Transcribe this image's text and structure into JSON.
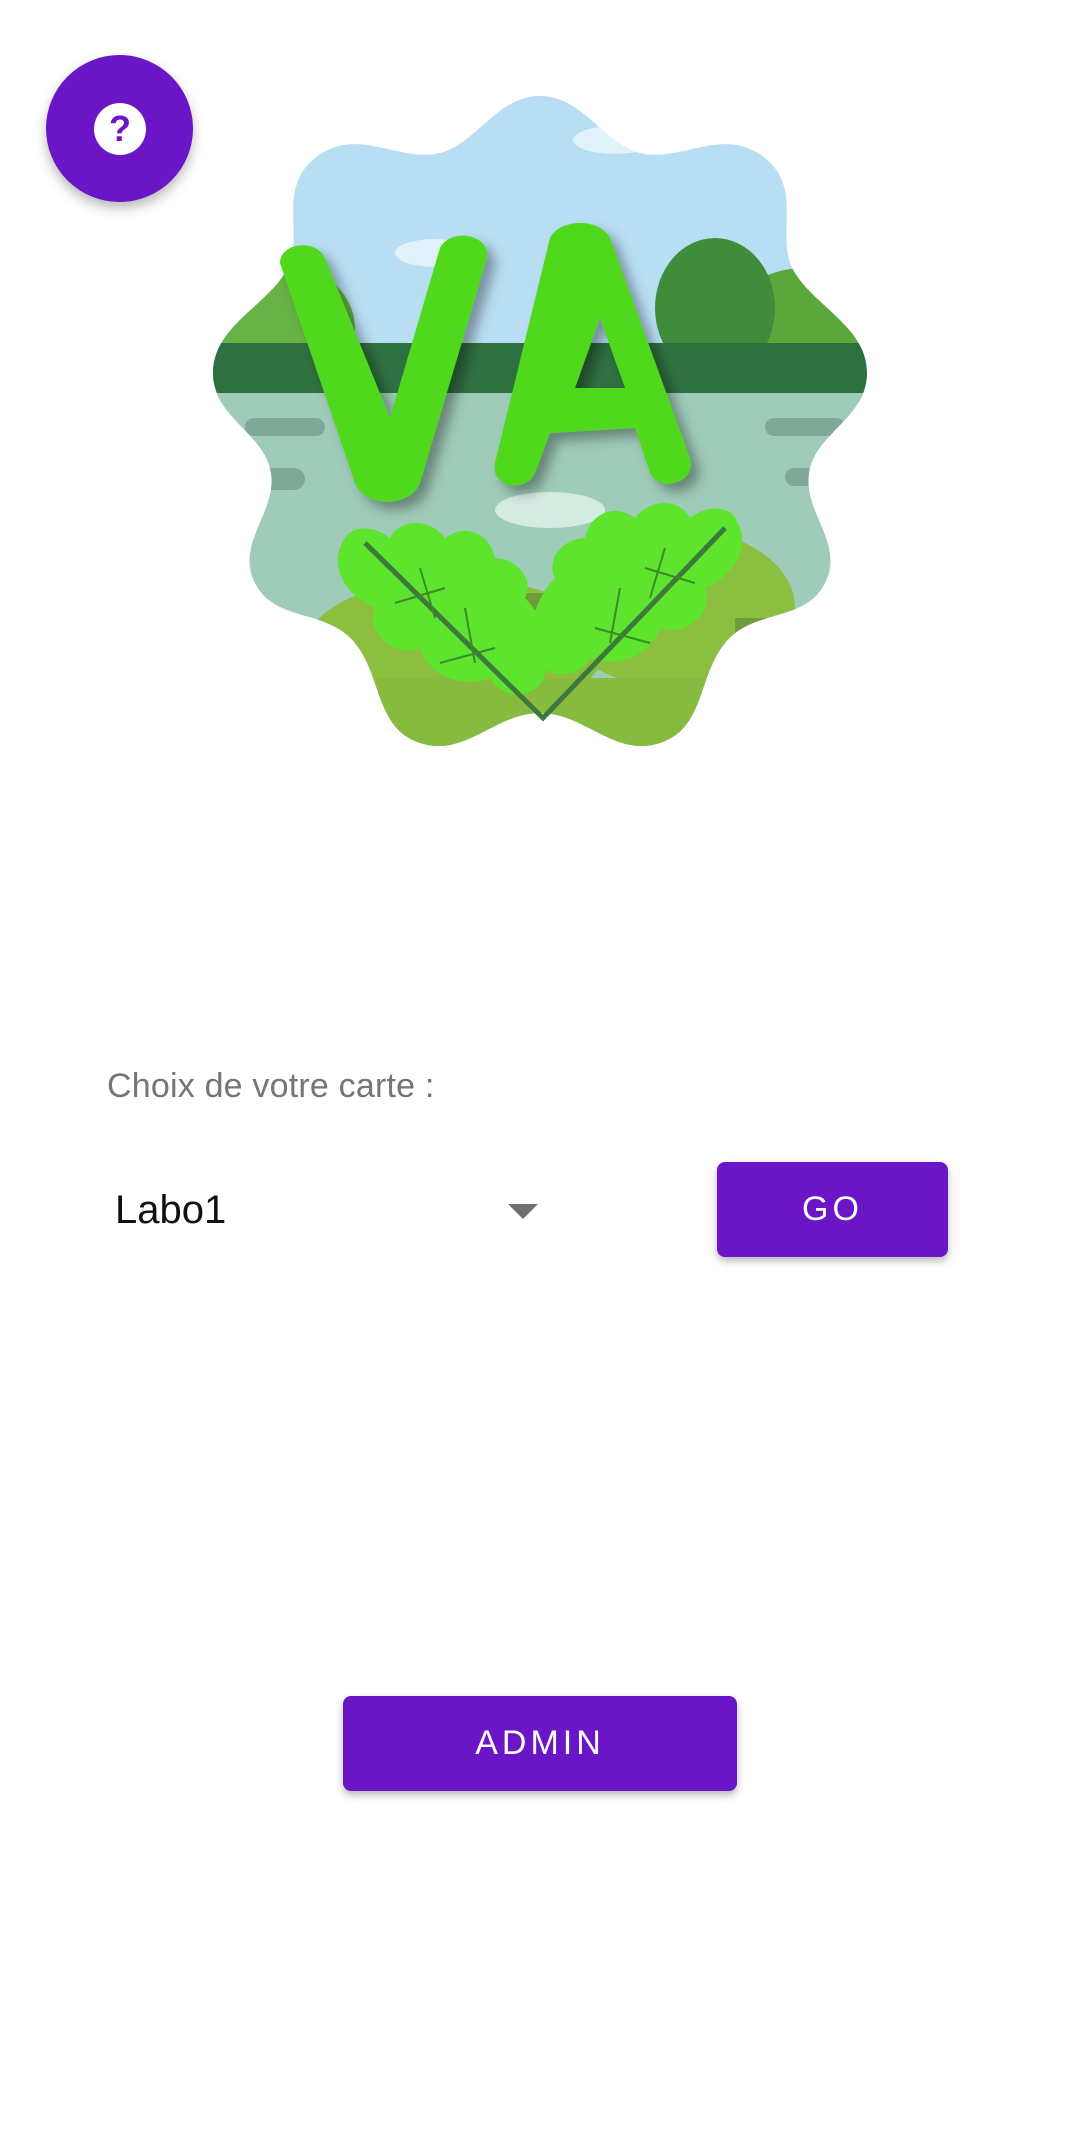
{
  "help_button": {
    "icon": "help-icon",
    "color": "#6a16c6"
  },
  "logo": {
    "letters": "VA",
    "icon": "va-leaf-logo"
  },
  "map_selection": {
    "label": "Choix de votre carte :",
    "selected": "Labo1",
    "dropdown_icon": "dropdown-arrow-icon"
  },
  "actions": {
    "go_label": "GO",
    "admin_label": "ADMIN"
  },
  "colors": {
    "accent": "#6a16c6",
    "logo_green": "#4fd81c"
  }
}
